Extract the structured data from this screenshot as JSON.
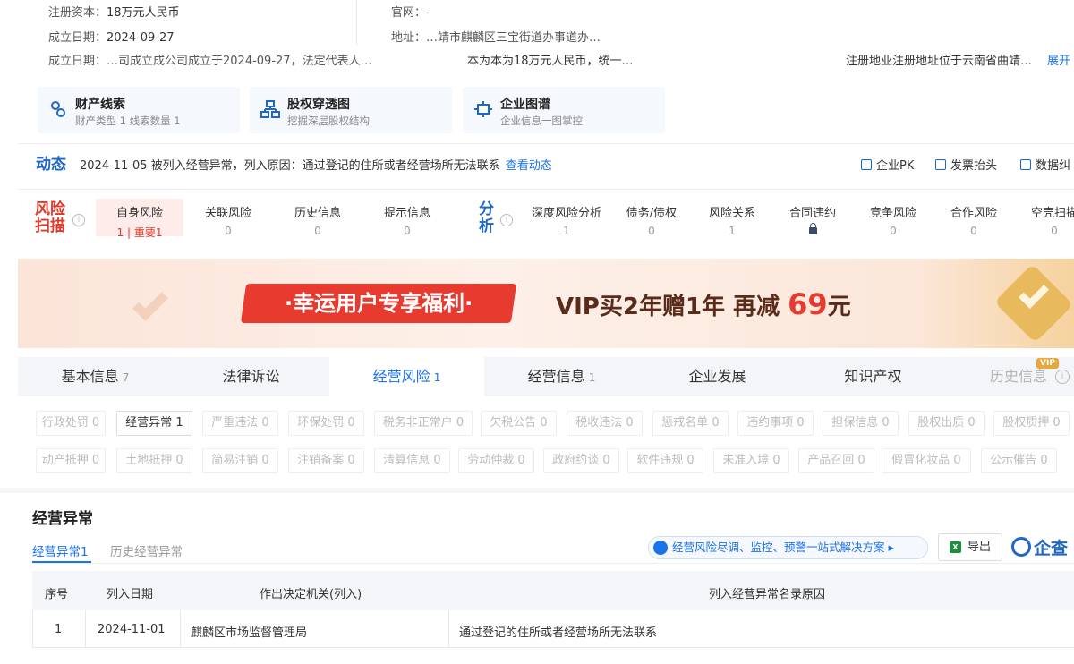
{
  "company_info": {
    "capital_label": "注册资本：",
    "capital_value": "18万元人民币",
    "founded_label": "成立日期：",
    "founded_value": "2024-09-27",
    "website_label": "官网：",
    "website_value": "-",
    "address_label": "地址：",
    "address_value": "…靖市麒麟区三宝街道办事道办…",
    "summary_label": "成立日期：",
    "summary_part1": "…司成立成公司成立于2024-09-27，法定代表人…",
    "summary_part2": "本为本为18万元人民币，统一…",
    "summary_part3": "注册地业注册地址位于云南省曲靖…",
    "expand_label": "展开"
  },
  "cards": [
    {
      "title": "财产线索",
      "sub": "财产类型 1  线索数量 1",
      "icon": "property-clue-icon"
    },
    {
      "title": "股权穿透图",
      "sub": "挖掘深层股权结构",
      "icon": "equity-tree-icon"
    },
    {
      "title": "企业图谱",
      "sub": "企业信息一图掌控",
      "icon": "enterprise-graph-icon"
    }
  ],
  "dynamic": {
    "title": "动态",
    "text": "2024-11-05 被列入经营异常，列入原因：通过登记的住所或者经营场所无法联系",
    "link": "查看动态"
  },
  "tools": [
    {
      "label": "企业PK",
      "icon": "pk-icon"
    },
    {
      "label": "发票抬头",
      "icon": "invoice-icon"
    },
    {
      "label": "数据纠",
      "icon": "data-correct-icon"
    }
  ],
  "risk_scan": {
    "title_line1": "风险",
    "title_line2": "扫描",
    "items": [
      {
        "label": "自身风险",
        "value": "1 | 重要1"
      },
      {
        "label": "关联风险",
        "value": "0"
      },
      {
        "label": "历史信息",
        "value": "0"
      },
      {
        "label": "提示信息",
        "value": "0"
      }
    ]
  },
  "analysis": {
    "title_line1": "分",
    "title_line2": "析",
    "items": [
      {
        "label": "深度风险分析",
        "value": "1"
      },
      {
        "label": "债务/债权",
        "value": "0"
      },
      {
        "label": "风险关系",
        "value": "1"
      },
      {
        "label": "合同违约",
        "value": ""
      },
      {
        "label": "竞争风险",
        "value": "0"
      },
      {
        "label": "合作风险",
        "value": "0"
      },
      {
        "label": "空壳扫描",
        "value": "0"
      }
    ]
  },
  "banner": {
    "pill": "·幸运用户专享福利·",
    "offer": "VIP买2年赠1年  再减",
    "amount": "69",
    "unit": "元"
  },
  "tabs": [
    {
      "label": "基本信息",
      "count": "7"
    },
    {
      "label": "法律诉讼",
      "count": ""
    },
    {
      "label": "经营风险",
      "count": "1"
    },
    {
      "label": "经营信息",
      "count": "1"
    },
    {
      "label": "企业发展",
      "count": ""
    },
    {
      "label": "知识产权",
      "count": ""
    },
    {
      "label": "历史信息",
      "count": ""
    }
  ],
  "vip_tag": "VIP",
  "filters_row1": [
    "行政处罚 0",
    "经营异常 1",
    "严重违法 0",
    "环保处罚 0",
    "税务非正常户 0",
    "欠税公告 0",
    "税收违法 0",
    "惩戒名单 0",
    "违约事项 0",
    "担保信息 0",
    "股权出质 0",
    "股权质押 0"
  ],
  "filters_row2": [
    "动产抵押 0",
    "土地抵押 0",
    "简易注销 0",
    "注销备案 0",
    "清算信息 0",
    "劳动仲裁 0",
    "政府约谈 0",
    "软件违规 0",
    "未准入境 0",
    "产品召回 0",
    "假冒化妆品 0",
    "公示催告 0"
  ],
  "section": {
    "title": "经营异常",
    "subtab_active": "经营异常",
    "subtab_active_count": "1",
    "subtab_inactive": "历史经营异常",
    "promo": "经营风险尽调、监控、预警一站式解决方案 ▸",
    "export": "导出",
    "brand": "企查"
  },
  "table": {
    "headers": [
      "序号",
      "列入日期",
      "作出决定机关(列入)",
      "列入经营异常名录原因"
    ],
    "rows": [
      [
        "1",
        "2024-11-01",
        "麒麟区市场监督管理局",
        "通过登记的住所或者经营场所无法联系"
      ]
    ]
  },
  "colors": {
    "primary": "#1a73e8",
    "brand": "#1f67c2",
    "risk_red": "#e0392b",
    "banner_red": "#e63b2e"
  }
}
